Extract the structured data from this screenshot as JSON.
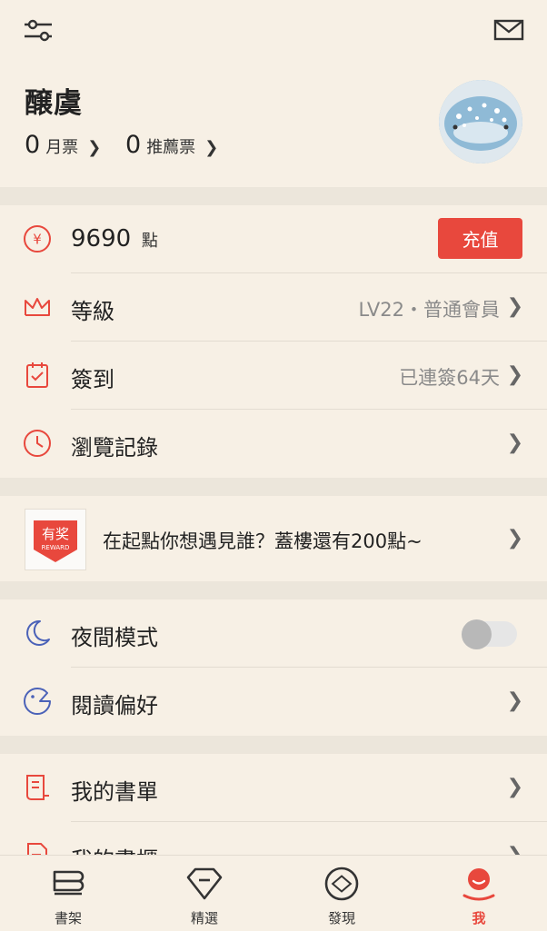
{
  "colors": {
    "background": "#f7f0e5",
    "accent": "#e8483d",
    "muted": "#8a8a8a",
    "blue_icon": "#4b62b8"
  },
  "top_bar": {
    "left_icon": "settings-sliders-icon",
    "right_icon": "mail-icon"
  },
  "profile": {
    "username": "醸虞",
    "monthly_ticket": {
      "count": "0",
      "label": "月票"
    },
    "recommend_ticket": {
      "count": "0",
      "label": "推薦票"
    }
  },
  "wallet": {
    "points": "9690",
    "points_unit": "點",
    "recharge_label": "充值"
  },
  "menu_main": [
    {
      "key": "level",
      "label": "等級",
      "value": "LV22・普通會員"
    },
    {
      "key": "checkin",
      "label": "簽到",
      "value": "已連簽64天"
    },
    {
      "key": "history",
      "label": "瀏覽記錄",
      "value": ""
    }
  ],
  "promo": {
    "badge_text": "有奖",
    "badge_sub": "REWARD",
    "text": "在起點你想遇見誰？蓋樓還有200點~"
  },
  "menu_settings": [
    {
      "key": "night",
      "label": "夜間模式",
      "toggle_on": false
    },
    {
      "key": "reading",
      "label": "閱讀偏好"
    }
  ],
  "menu_books": [
    {
      "key": "booklist",
      "label": "我的書單"
    },
    {
      "key": "bookshelf",
      "label": "我的書櫃"
    }
  ],
  "tabs": [
    {
      "key": "shelf",
      "label": "書架",
      "icon": "bookshelf-icon",
      "active": false
    },
    {
      "key": "featured",
      "label": "精選",
      "icon": "diamond-icon",
      "active": false
    },
    {
      "key": "discover",
      "label": "發現",
      "icon": "compass-icon",
      "active": false
    },
    {
      "key": "me",
      "label": "我",
      "icon": "profile-icon",
      "active": true
    }
  ]
}
